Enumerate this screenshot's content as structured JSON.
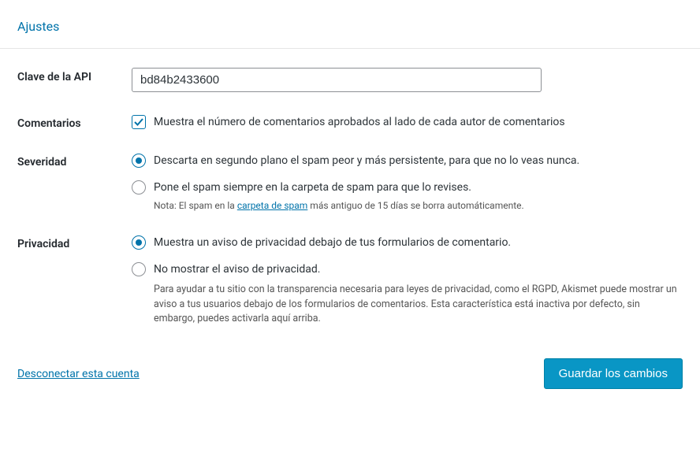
{
  "header": {
    "title": "Ajustes"
  },
  "api_key": {
    "label": "Clave de la API",
    "value": "bd84b2433600"
  },
  "comments": {
    "label": "Comentarios",
    "checkbox_label": "Muestra el número de comentarios aprobados al lado de cada autor de comentarios",
    "checked": true
  },
  "severity": {
    "label": "Severidad",
    "option1": "Descarta en segundo plano el spam peor y más persistente, para que no lo veas nunca.",
    "option2": "Pone el spam siempre en la carpeta de spam para que lo revises.",
    "note_prefix": "Nota: El spam en la ",
    "note_link": "carpeta de spam",
    "note_suffix": " más antiguo de 15 días se borra automáticamente.",
    "selected": 1
  },
  "privacy": {
    "label": "Privacidad",
    "option1": "Muestra un aviso de privacidad debajo de tus formularios de comentario.",
    "option2": "No mostrar el aviso de privacidad.",
    "help": "Para ayudar a tu sitio con la transparencia necesaria para leyes de privacidad, como el RGPD, Akismet puede mostrar un aviso a tus usuarios debajo de los formularios de comentarios. Esta característica está inactiva por defecto, sin embargo, puedes activarla aquí arriba.",
    "selected": 1
  },
  "footer": {
    "disconnect": "Desconectar esta cuenta",
    "save": "Guardar los cambios"
  }
}
